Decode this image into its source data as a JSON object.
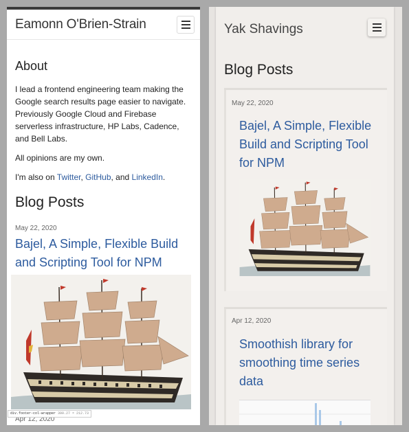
{
  "left": {
    "site_title": "Eamonn O'Brien-Strain",
    "about_heading": "About",
    "about_p1": "I lead a frontend engineering team making the Google search results page easier to navigate. Previously Google Cloud and Firebase serverless infrastructure, HP Labs, Cadence, and Bell Labs.",
    "about_p2": "All opinions are my own.",
    "also_on_prefix": "I'm also on ",
    "twitter": "Twitter",
    "comma": ", ",
    "github": "GitHub",
    "and": ", and ",
    "linkedin": "LinkedIn",
    "period": ".",
    "blog_heading": "Blog Posts",
    "post1_date": "May 22, 2020",
    "post1_title": "Bajel, A Simple, Flexible Build and Scripting Tool for NPM",
    "post2_date": "Apr 12, 2020"
  },
  "right": {
    "site_title": "Yak Shavings",
    "blog_heading": "Blog Posts",
    "post1_date": "May 22, 2020",
    "post1_title": "Bajel, A Simple, Flexible Build and Scripting Tool for NPM",
    "post2_date": "Apr 12, 2020",
    "post2_title": "Smoothish library for smoothing time series data",
    "tooltip_selector": "div.footer-col-wrapper",
    "tooltip_size": "300.27 × 212.73"
  },
  "icons": {
    "menu": "hamburger-menu-icon"
  },
  "colors": {
    "link": "#2d5b9e",
    "background": "#a9a9a9"
  }
}
